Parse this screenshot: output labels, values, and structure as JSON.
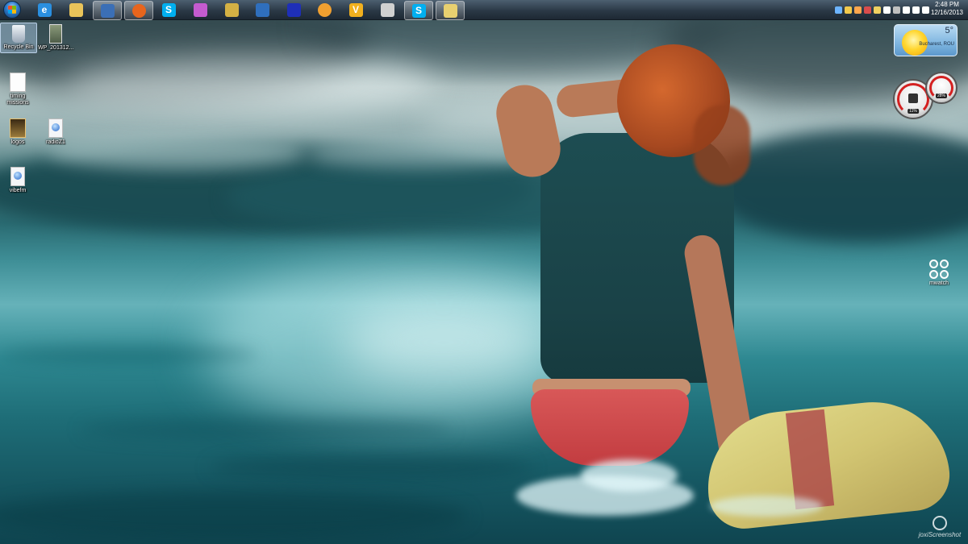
{
  "taskbar": {
    "apps": [
      {
        "icon": "internet-explorer-icon",
        "color": "#2a8fe0",
        "glyph": "e",
        "active": false
      },
      {
        "icon": "file-explorer-icon",
        "color": "#e9c45a",
        "glyph": "",
        "active": false
      },
      {
        "icon": "thunderbird-mail-icon",
        "color": "#3b6fb6",
        "glyph": "",
        "active": true
      },
      {
        "icon": "firefox-icon",
        "color": "#e8651d",
        "glyph": "",
        "active": true
      },
      {
        "icon": "skype-icon",
        "color": "#00aff0",
        "glyph": "S",
        "active": false
      },
      {
        "icon": "messenger-icon",
        "color": "#c45bd0",
        "glyph": "",
        "active": false
      },
      {
        "icon": "tools-icon",
        "color": "#d4b144",
        "glyph": "",
        "active": false
      },
      {
        "icon": "remote-desktop-icon",
        "color": "#2f6fbd",
        "glyph": "",
        "active": false
      },
      {
        "icon": "screen-capture-icon",
        "color": "#1e2fb8",
        "glyph": "",
        "active": false
      },
      {
        "icon": "media-player-icon",
        "color": "#f0a030",
        "glyph": "",
        "active": false
      },
      {
        "icon": "vlc-v-icon",
        "color": "#f2b01e",
        "glyph": "V",
        "active": false
      },
      {
        "icon": "utility-icon",
        "color": "#d0d0d0",
        "glyph": "",
        "active": false
      },
      {
        "icon": "skype-icon",
        "color": "#00aff0",
        "glyph": "S",
        "active": true
      },
      {
        "icon": "chat-bubble-icon",
        "color": "#e8d070",
        "glyph": "",
        "active": true
      }
    ],
    "tray_colors": [
      "#6cb4ff",
      "#f2c94c",
      "#ffa64d",
      "#d94c4c",
      "#f0d060",
      "#ffffff",
      "#c0c0c0",
      "#ffffff",
      "#ffffff",
      "#ffffff"
    ],
    "time": "2:48 PM",
    "date": "12/16/2013"
  },
  "desktop_icons": [
    {
      "label": "Recycle Bin",
      "icon": "recycle-bin-icon",
      "selected": true
    },
    {
      "label": "WP_201312...",
      "icon": "image-file-icon",
      "selected": false
    },
    {
      "label": "timing missions",
      "icon": "text-document-icon",
      "selected": false
    },
    {
      "label": "logos",
      "icon": "folder-icon",
      "selected": false
    },
    {
      "label": "radioZ1",
      "icon": "internet-shortcut-icon",
      "selected": false
    },
    {
      "label": "vibefm",
      "icon": "internet-shortcut-icon",
      "selected": false
    }
  ],
  "weather_gadget": {
    "temperature": "5°",
    "location": "Bucharest, ROU"
  },
  "cpu_meter": {
    "cpu_value": "11%",
    "memory_value": "28%"
  },
  "mwatch": {
    "label": "mwatch"
  },
  "watermark": {
    "text": "joxiScreenshot"
  }
}
